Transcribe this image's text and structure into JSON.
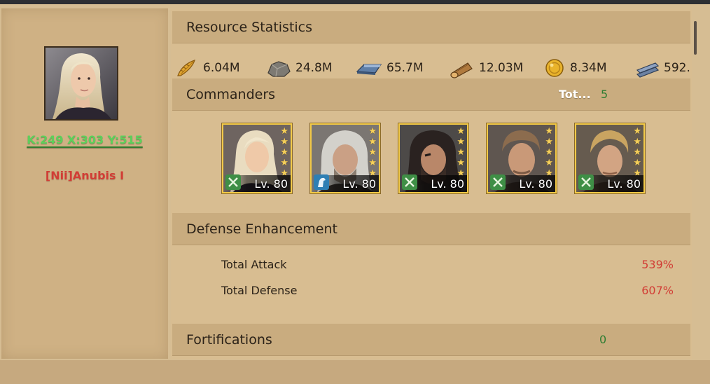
{
  "player": {
    "coords": "K:249 X:303 Y:515",
    "name": "[Nii]Anubis I"
  },
  "resources": {
    "title": "Resource Statistics",
    "items": [
      {
        "icon": "food-icon",
        "value": "6.04M"
      },
      {
        "icon": "stone-icon",
        "value": "24.8M"
      },
      {
        "icon": "iron-icon",
        "value": "65.7M"
      },
      {
        "icon": "wood-icon",
        "value": "12.03M"
      },
      {
        "icon": "gold-icon",
        "value": "8.34M"
      },
      {
        "icon": "steel-icon",
        "value": "592."
      }
    ]
  },
  "commanders": {
    "title": "Commanders",
    "total_label": "Tot...",
    "total_value": "5",
    "list": [
      {
        "level": "Lv. 80",
        "class_icon": "infantry-icon",
        "stars": 5
      },
      {
        "level": "Lv. 80",
        "class_icon": "cavalry-icon",
        "stars": 5
      },
      {
        "level": "Lv. 80",
        "class_icon": "infantry-icon",
        "stars": 5
      },
      {
        "level": "Lv. 80",
        "class_icon": "infantry-icon",
        "stars": 5
      },
      {
        "level": "Lv. 80",
        "class_icon": "infantry-icon",
        "stars": 5
      }
    ]
  },
  "defense": {
    "title": "Defense Enhancement",
    "attack_label": "Total Attack",
    "attack_value": "539%",
    "defense_label": "Total Defense",
    "defense_value": "607%"
  },
  "fortifications": {
    "title": "Fortifications",
    "value": "0"
  },
  "colors": {
    "accent_green": "#5dd05b",
    "accent_red": "#d23d35",
    "panel": "#d8bd91",
    "header": "#c9ac7f"
  }
}
